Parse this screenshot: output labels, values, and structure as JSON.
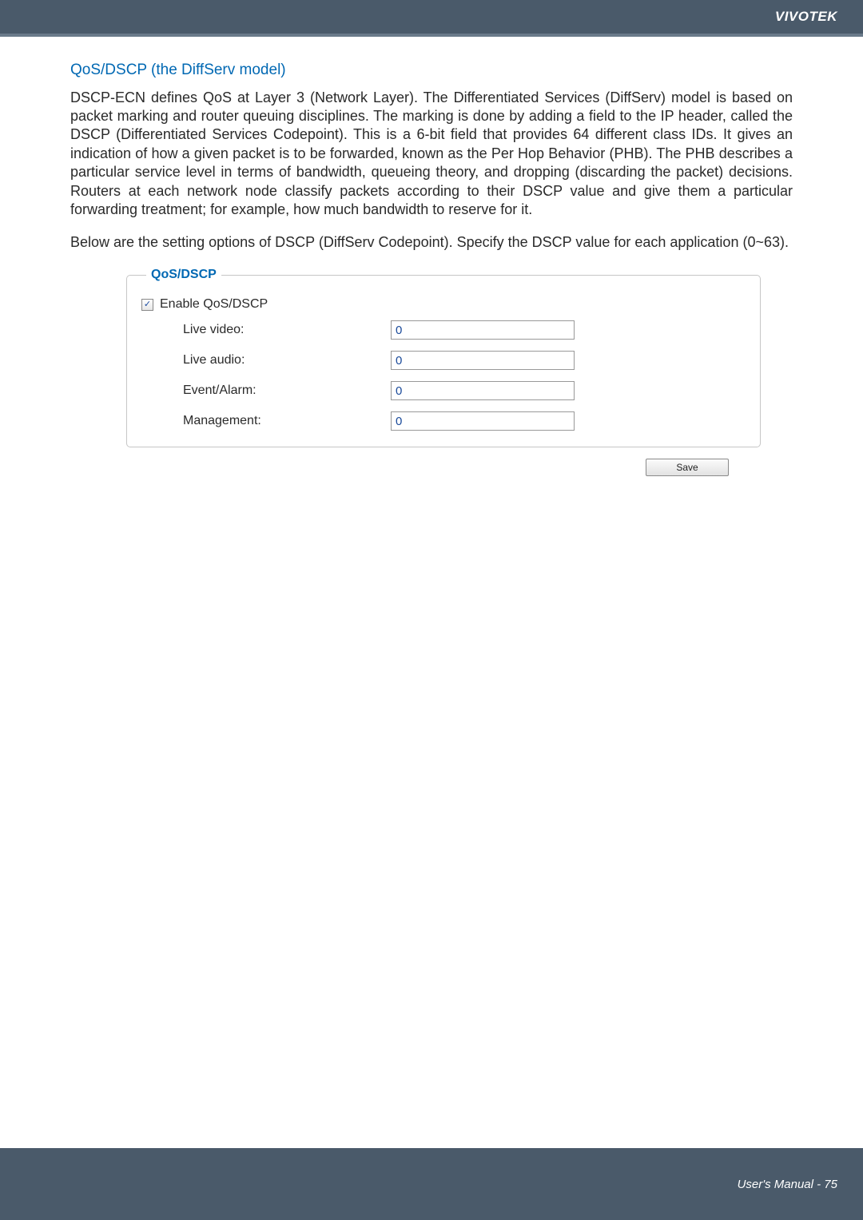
{
  "header": {
    "brand": "VIVOTEK"
  },
  "section": {
    "title": "QoS/DSCP (the DiffServ model)",
    "para1": "DSCP-ECN defines QoS at Layer 3 (Network Layer). The Differentiated Services (DiffServ) model is based on packet marking and router queuing disciplines. The marking is done by adding a field to the IP header, called the DSCP (Differentiated Services Codepoint). This is a 6-bit field that provides 64 different class IDs. It gives an indication of how a given packet is to be forwarded, known as the Per Hop Behavior (PHB). The PHB describes a particular service level in terms of bandwidth, queueing theory, and dropping (discarding the packet) decisions. Routers at each network node classify packets according to their DSCP value and give them a particular forwarding treatment; for example, how much bandwidth to reserve for it.",
    "para2": "Below are the setting options of DSCP (DiffServ Codepoint). Specify the DSCP value for each application (0~63)."
  },
  "fieldset": {
    "legend": "QoS/DSCP",
    "enable_label": "Enable QoS/DSCP",
    "enable_checked": true,
    "rows": [
      {
        "label": "Live video:",
        "value": "0"
      },
      {
        "label": "Live audio:",
        "value": "0"
      },
      {
        "label": "Event/Alarm:",
        "value": "0"
      },
      {
        "label": "Management:",
        "value": "0"
      }
    ]
  },
  "buttons": {
    "save": "Save"
  },
  "footer": {
    "text": "User's Manual - 75"
  }
}
